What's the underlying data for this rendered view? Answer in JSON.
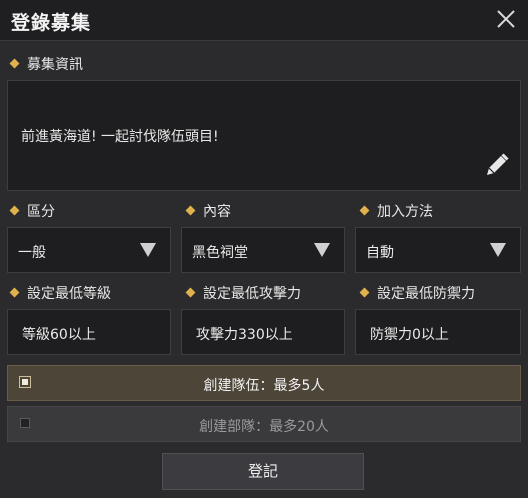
{
  "window": {
    "title": "登錄募集",
    "close_icon": "close-icon"
  },
  "recruit_info": {
    "label": "募集資訊",
    "text": "前進黃海道! 一起討伐隊伍頭目!",
    "edit_icon": "pencil-icon"
  },
  "selects": [
    {
      "label": "區分",
      "value": "一般"
    },
    {
      "label": "內容",
      "value": "黑色祠堂"
    },
    {
      "label": "加入方法",
      "value": "自動"
    }
  ],
  "requirements": [
    {
      "label": "設定最低等級",
      "value": "等級60以上"
    },
    {
      "label": "設定最低攻擊力",
      "value": "攻擊力330以上"
    },
    {
      "label": "設定最低防禦力",
      "value": "防禦力0以上"
    }
  ],
  "options": [
    {
      "label": "創建隊伍：最多5人",
      "checked": true
    },
    {
      "label": "創建部隊：最多20人",
      "checked": false
    }
  ],
  "submit_label": "登記",
  "colors": {
    "accent": "#e0b24e",
    "selected_option_bg": "#4e4539"
  }
}
